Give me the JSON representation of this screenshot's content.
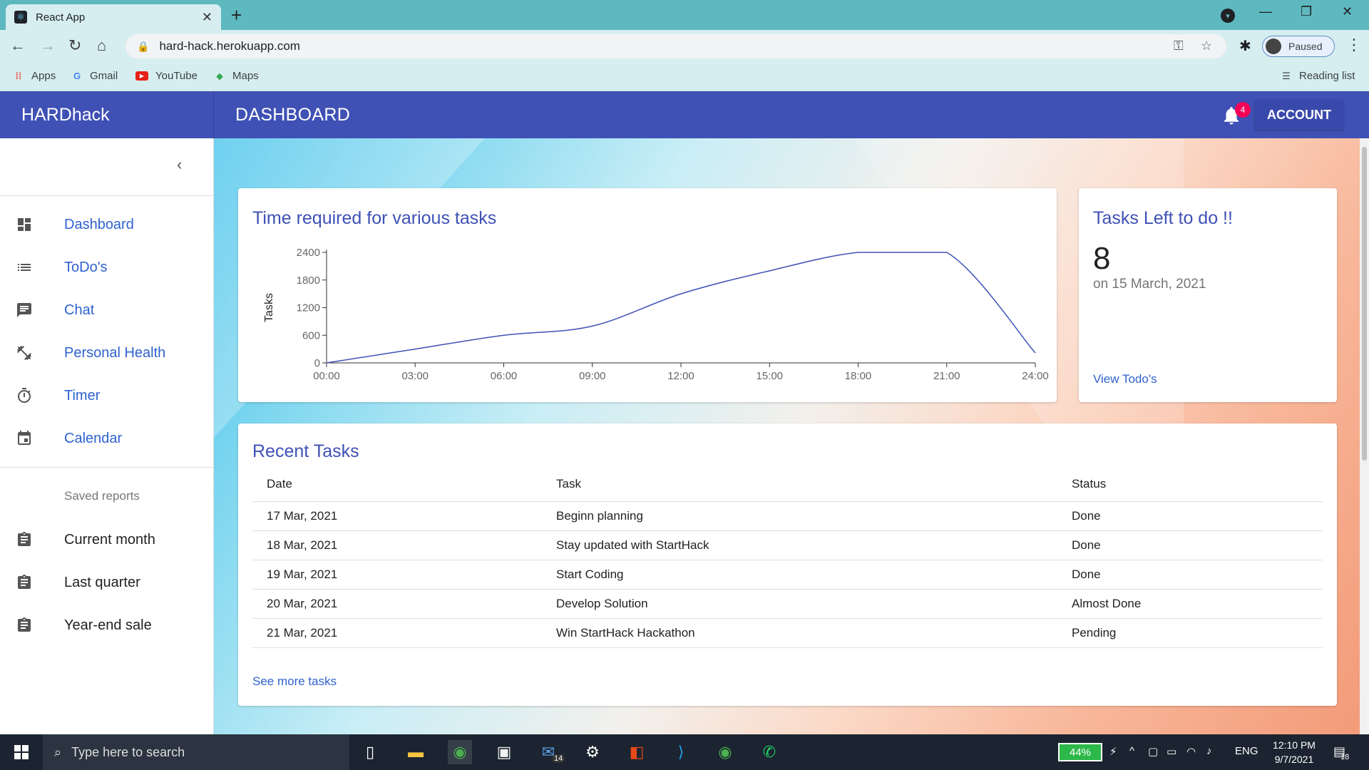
{
  "browser": {
    "tab_title": "React App",
    "url": "hard-hack.herokuapp.com",
    "profile_status": "Paused",
    "bookmarks": [
      {
        "label": "Apps",
        "icon": "apps-grid-icon"
      },
      {
        "label": "Gmail",
        "icon": "google-icon"
      },
      {
        "label": "YouTube",
        "icon": "youtube-icon"
      },
      {
        "label": "Maps",
        "icon": "maps-pin-icon"
      }
    ],
    "reading_list": "Reading list"
  },
  "app": {
    "brand": "HARDhack",
    "title": "DASHBOARD",
    "notification_count": "4",
    "account_label": "ACCOUNT"
  },
  "sidebar": {
    "items": [
      {
        "label": "Dashboard",
        "icon": "dashboard-icon"
      },
      {
        "label": "ToDo's",
        "icon": "list-icon"
      },
      {
        "label": "Chat",
        "icon": "chat-icon"
      },
      {
        "label": "Personal Health",
        "icon": "fitness-icon"
      },
      {
        "label": "Timer",
        "icon": "timer-icon"
      },
      {
        "label": "Calendar",
        "icon": "calendar-icon"
      }
    ],
    "saved_reports_heading": "Saved reports",
    "reports": [
      {
        "label": "Current month",
        "icon": "clipboard-icon"
      },
      {
        "label": "Last quarter",
        "icon": "clipboard-icon"
      },
      {
        "label": "Year-end sale",
        "icon": "clipboard-icon"
      }
    ]
  },
  "chart_card": {
    "title": "Time required for various tasks"
  },
  "chart_data": {
    "type": "line",
    "title": "Time required for various tasks",
    "xlabel": "",
    "ylabel": "Tasks",
    "x": [
      "00:00",
      "03:00",
      "06:00",
      "09:00",
      "12:00",
      "15:00",
      "18:00",
      "21:00",
      "24:00"
    ],
    "series": [
      {
        "values": [
          0,
          300,
          600,
          800,
          1500,
          2000,
          2400,
          2400,
          null
        ]
      }
    ],
    "ylim": [
      0,
      2400
    ],
    "yticks": [
      0,
      600,
      1200,
      1800,
      2400
    ],
    "color": "#3f51b5",
    "grid": false
  },
  "tasks_left": {
    "title": "Tasks Left to do !!",
    "count": "8",
    "date": "on 15 March, 2021",
    "link": "View Todo's"
  },
  "recent_tasks": {
    "title": "Recent Tasks",
    "columns": [
      "Date",
      "Task",
      "Status"
    ],
    "rows": [
      [
        "17 Mar, 2021",
        "Beginn planning",
        "Done"
      ],
      [
        "18 Mar, 2021",
        "Stay updated with StartHack",
        "Done"
      ],
      [
        "19 Mar, 2021",
        "Start Coding",
        "Done"
      ],
      [
        "20 Mar, 2021",
        "Develop Solution",
        "Almost Done"
      ],
      [
        "21 Mar, 2021",
        "Win StartHack Hackathon",
        "Pending"
      ]
    ],
    "see_more": "See more tasks"
  },
  "taskbar": {
    "search_placeholder": "Type here to search",
    "mail_badge": "14",
    "battery": "44%",
    "language": "ENG",
    "time": "12:10 PM",
    "date": "9/7/2021",
    "notification_count": "18"
  }
}
